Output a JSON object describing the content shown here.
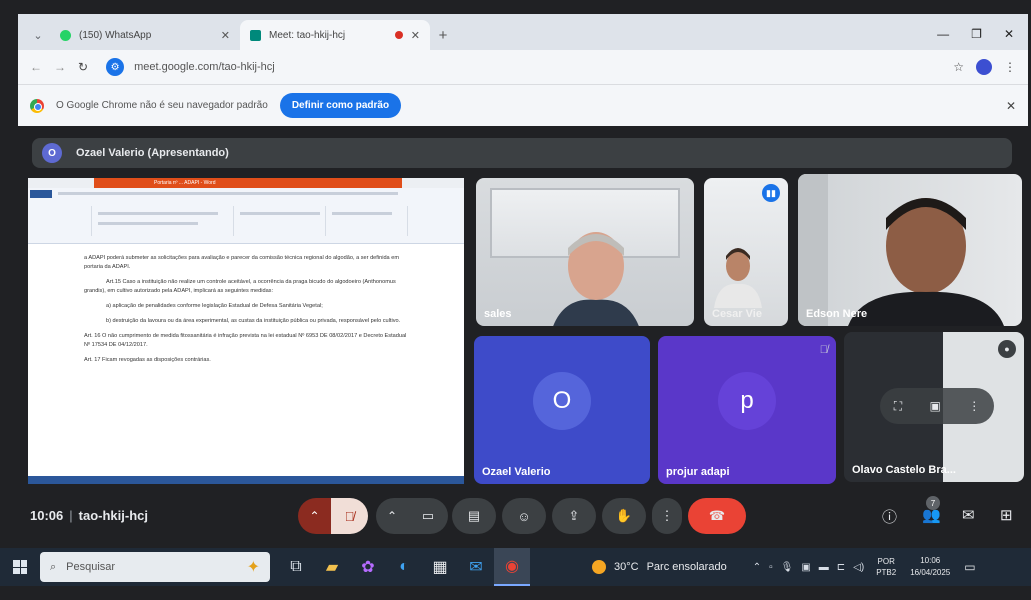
{
  "browser": {
    "tabs": [
      {
        "label": "(150) WhatsApp",
        "icon": "whatsapp-icon",
        "color": "#25d366"
      },
      {
        "label": "Meet: tao-hkij-hcj",
        "icon": "meet-icon",
        "color": "#00897b"
      }
    ],
    "url": "meet.google.com/tao-hkij-hcj",
    "infobar": {
      "message": "O Google Chrome não é seu navegador padrão",
      "button": "Definir como padrão"
    }
  },
  "meet": {
    "presenter_label": "Ozael Valerio (Apresentando)",
    "presenter_initial": "O",
    "code": "tao-hkij-hcj",
    "time": "10:06",
    "participants_count": "7",
    "document_title": "Portaria nº ... ADAPI - Word",
    "document": {
      "p1": "a ADAPI poderá submeter as solicitações para avaliação e parecer da comissão técnica regional do algodão, a ser definida em portaria da ADAPI.",
      "p2": "Art.15 Caso a instituição não realize um controle aceitável, a ocorrência da praga bicudo do algodoeiro (Anthonomus grandis), em cultivo autorizado pela ADAPI, implicará as seguintes medidas:",
      "p3": "a) aplicação de penalidades conforme legislação Estadual de Defesa Sanitária Vegetal;",
      "p4": "b) destruição da lavoura ou da área experimental, as custas da instituição pública ou privada, responsável pelo cultivo.",
      "p5": "Art. 16 O não cumprimento de medida fitossanitária é infração prevista na lei estadual Nº 6953 DE 08/02/2017 e Decreto Estadual Nº 17534 DE 04/12/2017.",
      "p6": "Art. 17 Ficam revogadas as disposições contrárias."
    },
    "participants": [
      {
        "name": "sales"
      },
      {
        "name": "Cesar Vie"
      },
      {
        "name": "Edson Nere"
      },
      {
        "name": "Ozael Valerio",
        "initial": "O"
      },
      {
        "name": "projur adapi",
        "initial": "p"
      },
      {
        "name": "Olavo Castelo Bra..."
      }
    ]
  },
  "taskbar": {
    "search_placeholder": "Pesquisar",
    "weather_temp": "30°C",
    "weather_text": "Parc ensolarado",
    "lang_1": "POR",
    "lang_2": "PTB2",
    "clock_time": "10:06",
    "clock_date": "16/04/2025"
  }
}
